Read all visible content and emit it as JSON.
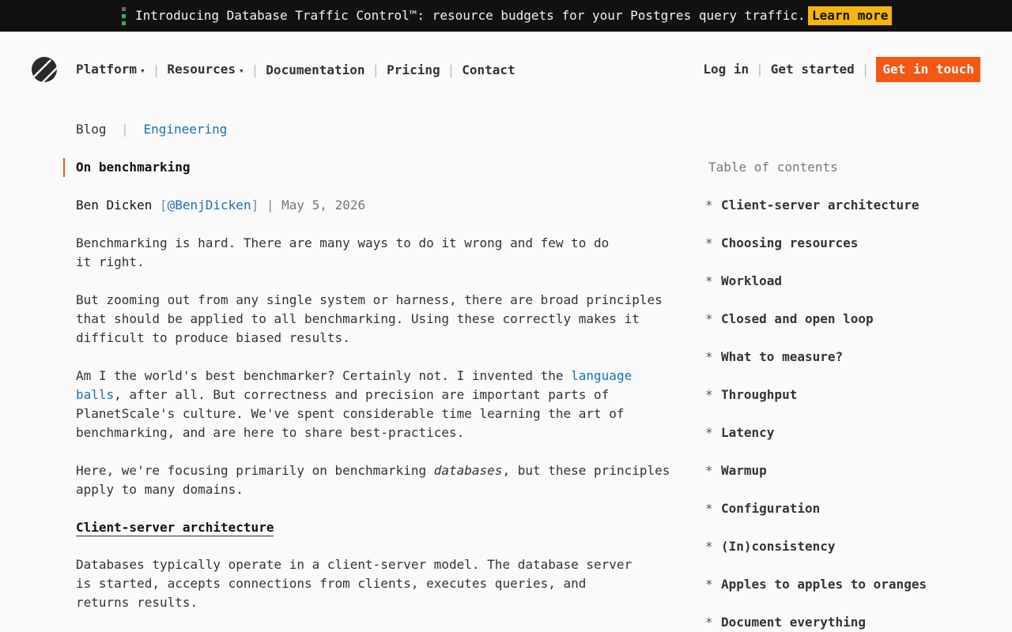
{
  "banner": {
    "text": "Introducing Database Traffic Control™: resource budgets for your Postgres query traffic.",
    "button": "Learn more"
  },
  "nav": {
    "sep": "|",
    "platform": "Platform",
    "resources": "Resources",
    "caret": "▾",
    "documentation": "Documentation",
    "pricing": "Pricing",
    "contact": "Contact",
    "login": "Log in",
    "get_started": "Get started",
    "get_in_touch": "Get in touch"
  },
  "breadcrumb": {
    "blog": "Blog",
    "sep": "|",
    "engineering": "Engineering"
  },
  "post": {
    "title": "On benchmarking",
    "author": "Ben Dicken",
    "bracket_open": "[",
    "handle": "@BenjDicken",
    "bracket_close": "]",
    "sep": "|",
    "date": "May 5, 2026"
  },
  "article": {
    "p1": "Benchmarking is hard. There are many ways to do it wrong and few to do\nit right.",
    "p2": "But zooming out from any single system or harness, there are broad principles\nthat should be applied to all benchmarking. Using these correctly makes it\ndifficult to produce biased results.",
    "p3_pre": "Am I the world's best benchmarker? Certainly not. I invented the ",
    "p3_link": "language\nballs",
    "p3_post": ", after all. But correctness and precision are important parts of\nPlanetScale's culture. We've spent considerable time learning the art of\nbenchmarking, and are here to share best-practices.",
    "p4_pre": "Here, we're focusing primarily on benchmarking ",
    "p4_em": "databases",
    "p4_post": ", but these principles\napply to many domains.",
    "h_client_server": "Client-server architecture",
    "p5": "Databases typically operate in a client-server model. The database server\nis started, accepts connections from clients, executes queries, and\nreturns results."
  },
  "toc": {
    "title": "Table of contents",
    "bullet": "*",
    "items": [
      "Client-server architecture",
      "Choosing resources",
      "Workload",
      "Closed and open loop",
      "What to measure?",
      "Throughput",
      "Latency",
      "Warmup",
      "Configuration",
      "(In)consistency",
      "Apples to apples to oranges",
      "Document everything"
    ]
  },
  "colors": {
    "accent": "#f35815",
    "banner_button": "#f5b50a",
    "link": "#1a6fb5"
  }
}
